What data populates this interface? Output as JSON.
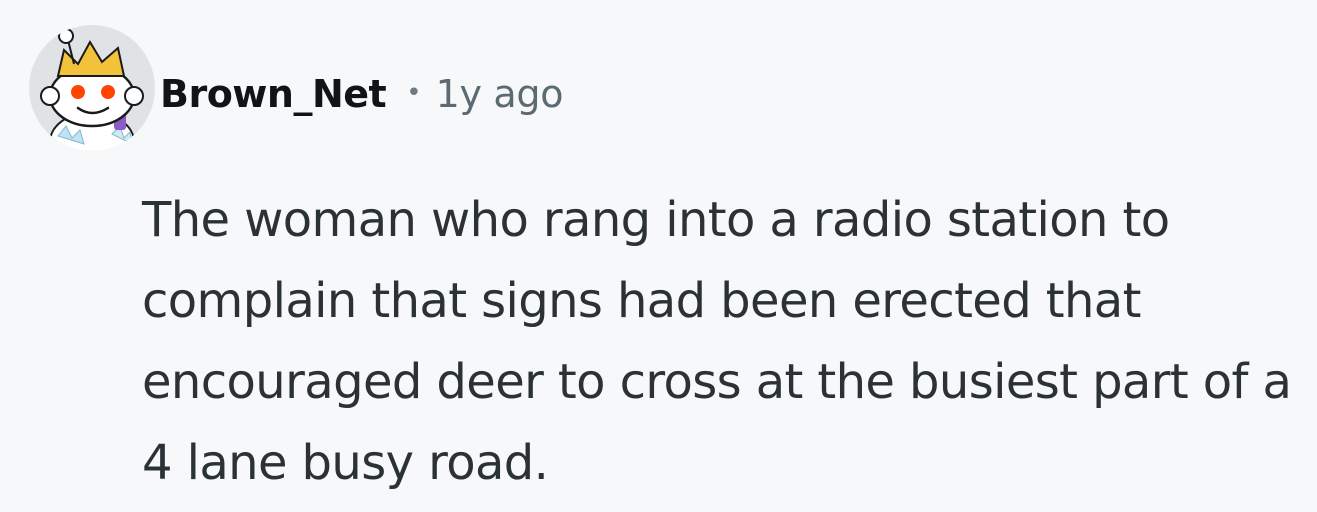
{
  "comment": {
    "author": "Brown_Net",
    "separator": "•",
    "timestamp": "1y ago",
    "body": "The woman who rang into a radio station to complain that signs had been erected that encouraged deer to cross at the busiest part of a 4 lane busy road.",
    "avatar_icon": "snoo-avatar-icon"
  },
  "colors": {
    "background": "#f7f8f9",
    "author_text": "#111416",
    "timestamp_text": "#5c6a72",
    "body_text": "#2a3236",
    "avatar_eye": "#ff4500",
    "avatar_crown": "#f2c23a"
  }
}
